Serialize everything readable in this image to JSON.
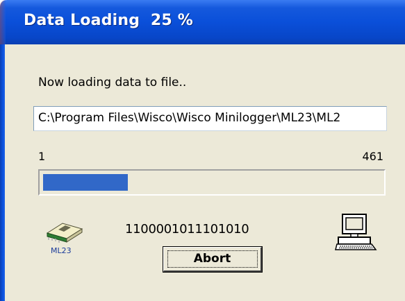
{
  "window": {
    "title": "Data Loading  25 %"
  },
  "dialog": {
    "status_text": "Now loading data to file..",
    "file_path": "C:\\Program Files\\Wisco\\Wisco Minilogger\\ML23\\ML2",
    "range_min": "1",
    "range_max": "461",
    "progress_fraction": 0.25,
    "bit_pattern": "1100001011101010",
    "device_label": "ML23",
    "abort_label": "Abort"
  },
  "icons": {
    "device": "logger-device-icon",
    "computer": "computer-icon"
  },
  "colors": {
    "title_bar": "#0a4fd9",
    "progress_fill": "#3168c8",
    "dialog_background": "#ece9d8"
  }
}
